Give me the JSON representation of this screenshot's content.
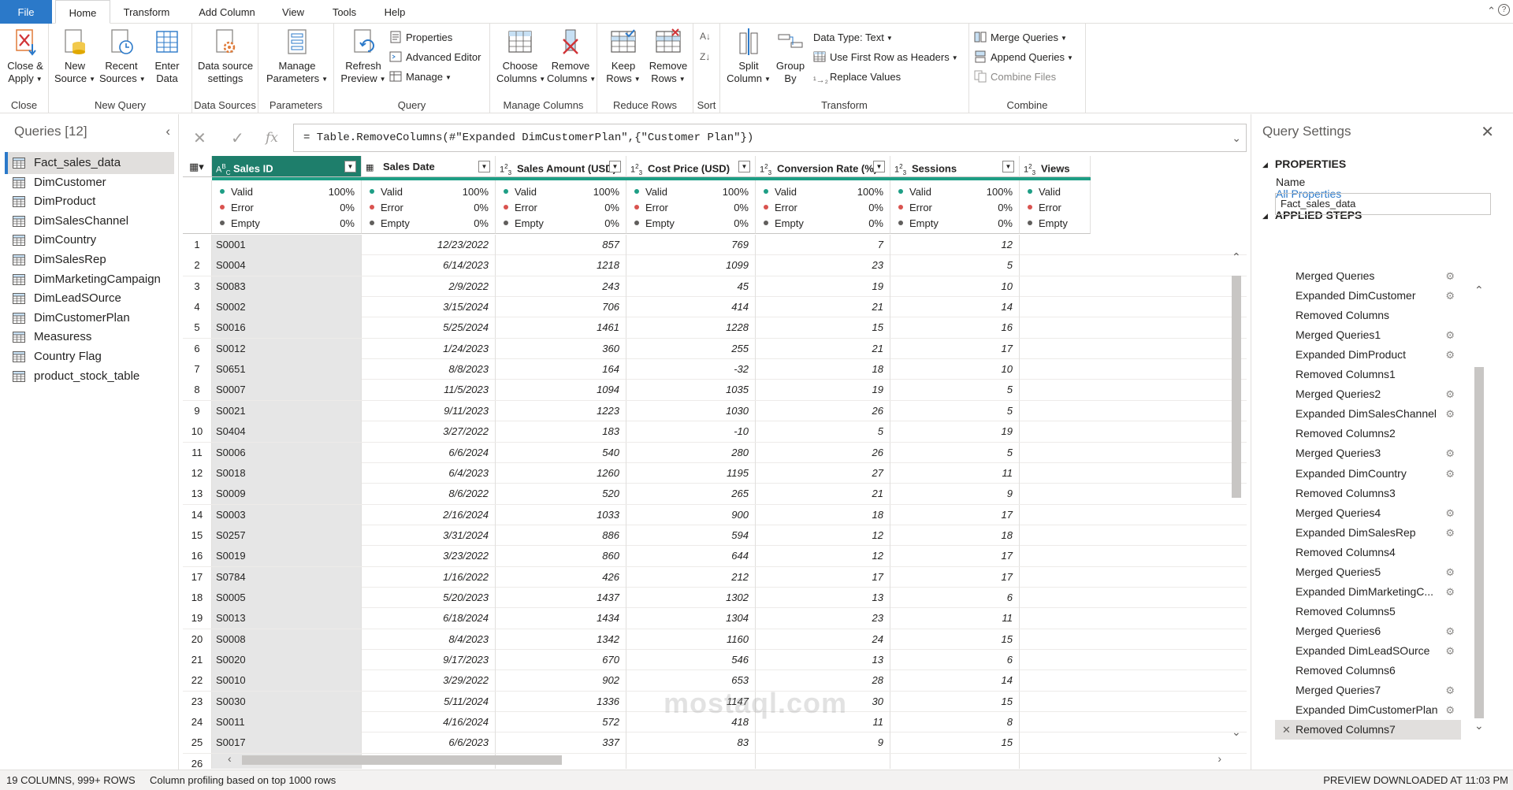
{
  "tabs": [
    "File",
    "Home",
    "Transform",
    "Add Column",
    "View",
    "Tools",
    "Help"
  ],
  "ribbon": {
    "close": {
      "close_apply": "Close &",
      "close_apply2": "Apply",
      "label": "Close"
    },
    "new_query": {
      "new_source": "New",
      "new_source2": "Source",
      "recent_sources": "Recent",
      "recent_sources2": "Sources",
      "enter_data": "Enter",
      "enter_data2": "Data",
      "label": "New Query"
    },
    "data_sources": {
      "settings": "Data source",
      "settings2": "settings",
      "label": "Data Sources"
    },
    "parameters": {
      "manage": "Manage",
      "manage2": "Parameters",
      "label": "Parameters"
    },
    "query": {
      "refresh": "Refresh",
      "refresh2": "Preview",
      "properties": "Properties",
      "advanced_editor": "Advanced Editor",
      "manage": "Manage",
      "label": "Query"
    },
    "manage_columns": {
      "choose": "Choose",
      "choose2": "Columns",
      "remove": "Remove",
      "remove2": "Columns",
      "label": "Manage Columns"
    },
    "reduce_rows": {
      "keep": "Keep",
      "keep2": "Rows",
      "remove": "Remove",
      "remove2": "Rows",
      "label": "Reduce Rows"
    },
    "sort": {
      "label": "Sort"
    },
    "transform": {
      "split": "Split",
      "split2": "Column",
      "group": "Group",
      "group2": "By",
      "data_type": "Data Type: Text",
      "first_row": "Use First Row as Headers",
      "replace": "Replace Values",
      "label": "Transform"
    },
    "combine": {
      "merge": "Merge Queries",
      "append": "Append Queries",
      "combine_files": "Combine Files",
      "label": "Combine"
    }
  },
  "formula": "= Table.RemoveColumns(#\"Expanded DimCustomerPlan\",{\"Customer Plan\"})",
  "queries": {
    "title": "Queries [12]",
    "items": [
      "Fact_sales_data",
      "DimCustomer",
      "DimProduct",
      "DimSalesChannel",
      "DimCountry",
      "DimSalesRep",
      "DimMarketingCampaign",
      "DimLeadSOurce",
      "DimCustomerPlan",
      "Measuress",
      "Country Flag",
      "product_stock_table"
    ]
  },
  "columns": [
    {
      "name": "Sales ID",
      "type": "ABC"
    },
    {
      "name": "Sales Date",
      "type": "cal"
    },
    {
      "name": "Sales Amount (USD)",
      "type": "123"
    },
    {
      "name": "Cost Price (USD)",
      "type": "123"
    },
    {
      "name": "Conversion Rate (%)",
      "type": "123"
    },
    {
      "name": "Sessions",
      "type": "123"
    },
    {
      "name": "Views",
      "type": "123"
    }
  ],
  "profile": {
    "valid": "Valid",
    "error": "Error",
    "empty": "Empty",
    "valid_pct": "100%",
    "error_pct": "0%",
    "empty_pct": "0%"
  },
  "rows": [
    [
      "1",
      "S0001",
      "12/23/2022",
      "857",
      "769",
      "7",
      "12"
    ],
    [
      "2",
      "S0004",
      "6/14/2023",
      "1218",
      "1099",
      "23",
      "5"
    ],
    [
      "3",
      "S0083",
      "2/9/2022",
      "243",
      "45",
      "19",
      "10"
    ],
    [
      "4",
      "S0002",
      "3/15/2024",
      "706",
      "414",
      "21",
      "14"
    ],
    [
      "5",
      "S0016",
      "5/25/2024",
      "1461",
      "1228",
      "15",
      "16"
    ],
    [
      "6",
      "S0012",
      "1/24/2023",
      "360",
      "255",
      "21",
      "17"
    ],
    [
      "7",
      "S0651",
      "8/8/2023",
      "164",
      "-32",
      "18",
      "10"
    ],
    [
      "8",
      "S0007",
      "11/5/2023",
      "1094",
      "1035",
      "19",
      "5"
    ],
    [
      "9",
      "S0021",
      "9/11/2023",
      "1223",
      "1030",
      "26",
      "5"
    ],
    [
      "10",
      "S0404",
      "3/27/2022",
      "183",
      "-10",
      "5",
      "19"
    ],
    [
      "11",
      "S0006",
      "6/6/2024",
      "540",
      "280",
      "26",
      "5"
    ],
    [
      "12",
      "S0018",
      "6/4/2023",
      "1260",
      "1195",
      "27",
      "11"
    ],
    [
      "13",
      "S0009",
      "8/6/2022",
      "520",
      "265",
      "21",
      "9"
    ],
    [
      "14",
      "S0003",
      "2/16/2024",
      "1033",
      "900",
      "18",
      "17"
    ],
    [
      "15",
      "S0257",
      "3/31/2024",
      "886",
      "594",
      "12",
      "18"
    ],
    [
      "16",
      "S0019",
      "3/23/2022",
      "860",
      "644",
      "12",
      "17"
    ],
    [
      "17",
      "S0784",
      "1/16/2022",
      "426",
      "212",
      "17",
      "17"
    ],
    [
      "18",
      "S0005",
      "5/20/2023",
      "1437",
      "1302",
      "13",
      "6"
    ],
    [
      "19",
      "S0013",
      "6/18/2024",
      "1434",
      "1304",
      "23",
      "11"
    ],
    [
      "20",
      "S0008",
      "8/4/2023",
      "1342",
      "1160",
      "24",
      "15"
    ],
    [
      "21",
      "S0020",
      "9/17/2023",
      "670",
      "546",
      "13",
      "6"
    ],
    [
      "22",
      "S0010",
      "3/29/2022",
      "902",
      "653",
      "28",
      "14"
    ],
    [
      "23",
      "S0030",
      "5/11/2024",
      "1336",
      "1147",
      "30",
      "15"
    ],
    [
      "24",
      "S0011",
      "4/16/2024",
      "572",
      "418",
      "11",
      "8"
    ],
    [
      "25",
      "S0017",
      "6/6/2023",
      "337",
      "83",
      "9",
      "15"
    ],
    [
      "26",
      "",
      "",
      "",
      "",
      "",
      ""
    ]
  ],
  "settings": {
    "title": "Query Settings",
    "properties": "PROPERTIES",
    "name_label": "Name",
    "name_value": "Fact_sales_data",
    "all_properties": "All Properties",
    "applied_steps": "APPLIED STEPS",
    "steps": [
      {
        "name": "Merged Queries",
        "gear": true
      },
      {
        "name": "Expanded DimCustomer",
        "gear": true
      },
      {
        "name": "Removed Columns",
        "gear": false
      },
      {
        "name": "Merged Queries1",
        "gear": true
      },
      {
        "name": "Expanded DimProduct",
        "gear": true
      },
      {
        "name": "Removed Columns1",
        "gear": false
      },
      {
        "name": "Merged Queries2",
        "gear": true
      },
      {
        "name": "Expanded DimSalesChannel",
        "gear": true
      },
      {
        "name": "Removed Columns2",
        "gear": false
      },
      {
        "name": "Merged Queries3",
        "gear": true
      },
      {
        "name": "Expanded DimCountry",
        "gear": true
      },
      {
        "name": "Removed Columns3",
        "gear": false
      },
      {
        "name": "Merged Queries4",
        "gear": true
      },
      {
        "name": "Expanded DimSalesRep",
        "gear": true
      },
      {
        "name": "Removed Columns4",
        "gear": false
      },
      {
        "name": "Merged Queries5",
        "gear": true
      },
      {
        "name": "Expanded DimMarketingC...",
        "gear": true
      },
      {
        "name": "Removed Columns5",
        "gear": false
      },
      {
        "name": "Merged Queries6",
        "gear": true
      },
      {
        "name": "Expanded DimLeadSOurce",
        "gear": true
      },
      {
        "name": "Removed Columns6",
        "gear": false
      },
      {
        "name": "Merged Queries7",
        "gear": true
      },
      {
        "name": "Expanded DimCustomerPlan",
        "gear": true
      },
      {
        "name": "Removed Columns7",
        "gear": false
      }
    ]
  },
  "status": {
    "columns_rows": "19 COLUMNS, 999+ ROWS",
    "profiling": "Column profiling based on top 1000 rows",
    "preview": "PREVIEW DOWNLOADED AT 11:03 PM"
  },
  "watermark": "mostaql.com",
  "colors": {
    "accent": "#2b79c9",
    "selected_header": "#1e7e6b",
    "valid": "#1e9e85",
    "error": "#d9534f",
    "empty": "#605e5c"
  }
}
